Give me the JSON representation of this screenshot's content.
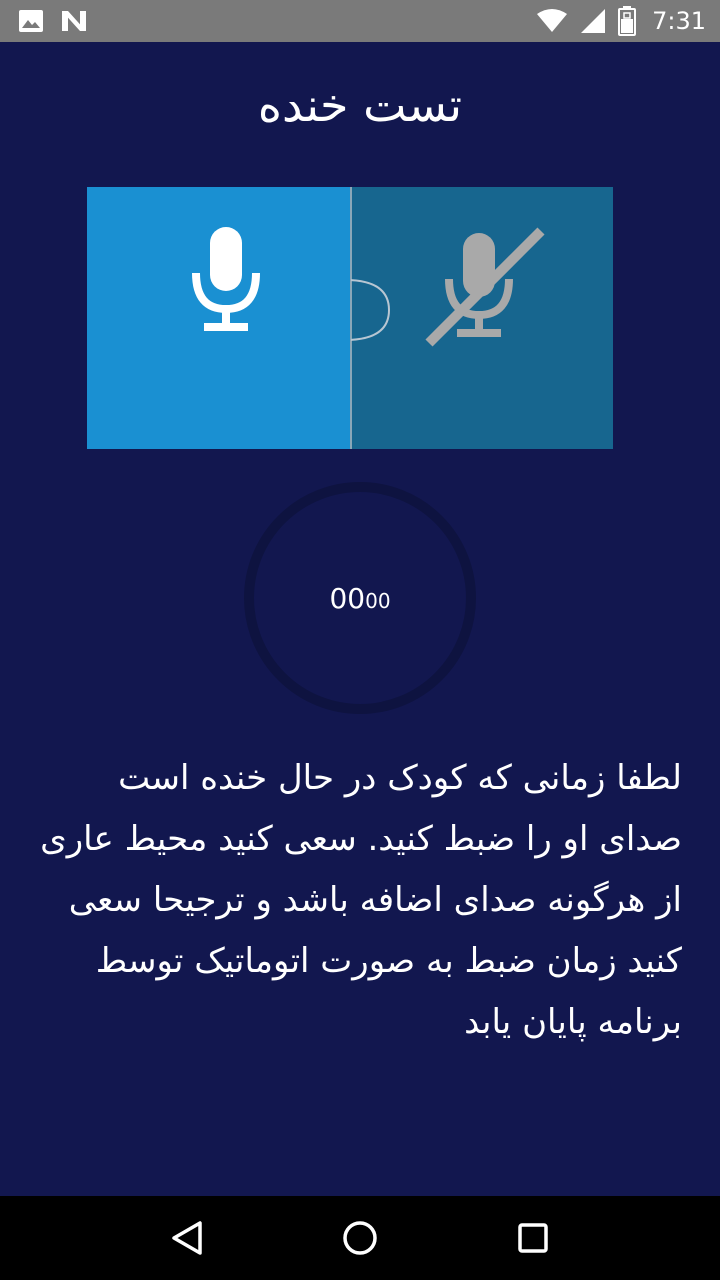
{
  "status_bar": {
    "time": "7:31",
    "icons": [
      "image-icon",
      "n-notification-icon",
      "wifi-icon",
      "signal-icon",
      "battery-icon"
    ],
    "background": "#7a7a7a"
  },
  "page": {
    "title": "تست خنده",
    "background": "#12174f"
  },
  "mic_toggle": {
    "on_icon": "microphone-icon",
    "off_icon": "microphone-off-icon",
    "on_color": "#1a90d2",
    "off_color": "#17668f"
  },
  "timer": {
    "seconds": "00",
    "hundredths": "00"
  },
  "instructions": {
    "text": "لطفا زمانی که کودک در حال خنده است صدای او را ضبط کنید. سعی کنید محیط عاری از هرگونه صدای اضافه باشد و ترجیحا سعی کنید زمان ضبط به صورت اتوماتیک توسط برنامه پایان یابد"
  },
  "nav_bar": {
    "icons": [
      "back-icon",
      "home-icon",
      "recents-icon"
    ]
  }
}
